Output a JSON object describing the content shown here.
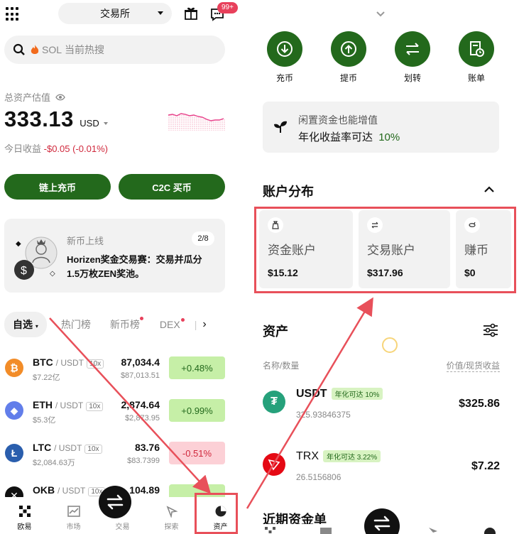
{
  "left": {
    "exchange_label": "交易所",
    "notification_badge": "99+",
    "search": {
      "hot_coin": "SOL",
      "placeholder": "当前热搜"
    },
    "total_assets_label": "总资产估值",
    "total_value": "333.13",
    "currency": "USD",
    "today_pnl_label": "今日收益",
    "today_pnl_value": "-$0.05 (-0.01%)",
    "buttons": {
      "deposit_onchain": "链上充币",
      "c2c_buy": "C2C 买币"
    },
    "promo": {
      "title": "新币上线",
      "page": "2/8",
      "text_line1": "Horizen奖金交易赛：交易并瓜分",
      "text_line2": "1.5万枚ZEN奖池。"
    },
    "tabs": [
      "自选",
      "热门榜",
      "新币榜",
      "DEX"
    ],
    "markets": [
      {
        "symbol": "BTC",
        "pair": "/ USDT",
        "lev": "10x",
        "vol": "$7.22亿",
        "price": "87,034.4",
        "price_usd": "$87,013.51",
        "change": "+0.48%",
        "dir": "up",
        "color": "#f28c28",
        "glyph": "₿"
      },
      {
        "symbol": "ETH",
        "pair": "/ USDT",
        "lev": "10x",
        "vol": "$5.3亿",
        "price": "2,874.64",
        "price_usd": "$2,873.95",
        "change": "+0.99%",
        "dir": "up",
        "color": "#627eea",
        "glyph": "◆"
      },
      {
        "symbol": "LTC",
        "pair": "/ USDT",
        "lev": "10x",
        "vol": "$2,084.63万",
        "price": "83.76",
        "price_usd": "$83.7399",
        "change": "-0.51%",
        "dir": "down",
        "color": "#2a5ead",
        "glyph": "Ł"
      },
      {
        "symbol": "OKB",
        "pair": "/ USDT",
        "lev": "10x",
        "vol": "",
        "price": "104.89",
        "price_usd": "",
        "change": "",
        "dir": "up",
        "color": "#111111",
        "glyph": "✕"
      }
    ],
    "nav": [
      "欧易",
      "市场",
      "交易",
      "探索",
      "资产"
    ]
  },
  "right": {
    "actions": [
      "充币",
      "提币",
      "划转",
      "账单"
    ],
    "earn": {
      "line1": "闲置资金也能增值",
      "line2_prefix": "年化收益率可达",
      "rate": "10%"
    },
    "distribution_title": "账户分布",
    "accounts": [
      {
        "name": "资金账户",
        "value": "$15.12"
      },
      {
        "name": "交易账户",
        "value": "$317.96"
      },
      {
        "name": "赚币",
        "value": "$0"
      }
    ],
    "assets_title": "资产",
    "col_left": "名称/数量",
    "col_right": "价值/现货收益",
    "assets": [
      {
        "symbol": "USDT",
        "tag": "年化可达 10%",
        "amount": "325.93846375",
        "value": "$325.86"
      },
      {
        "symbol": "TRX",
        "tag": "年化可达 3.22%",
        "amount": "26.5156806",
        "value": "$7.22"
      }
    ],
    "recent_label": "近期资金单"
  },
  "colors": {
    "brand_green": "#23691c",
    "up": "#23691c",
    "down": "#d0283c",
    "annotation_red": "#e8505a"
  }
}
